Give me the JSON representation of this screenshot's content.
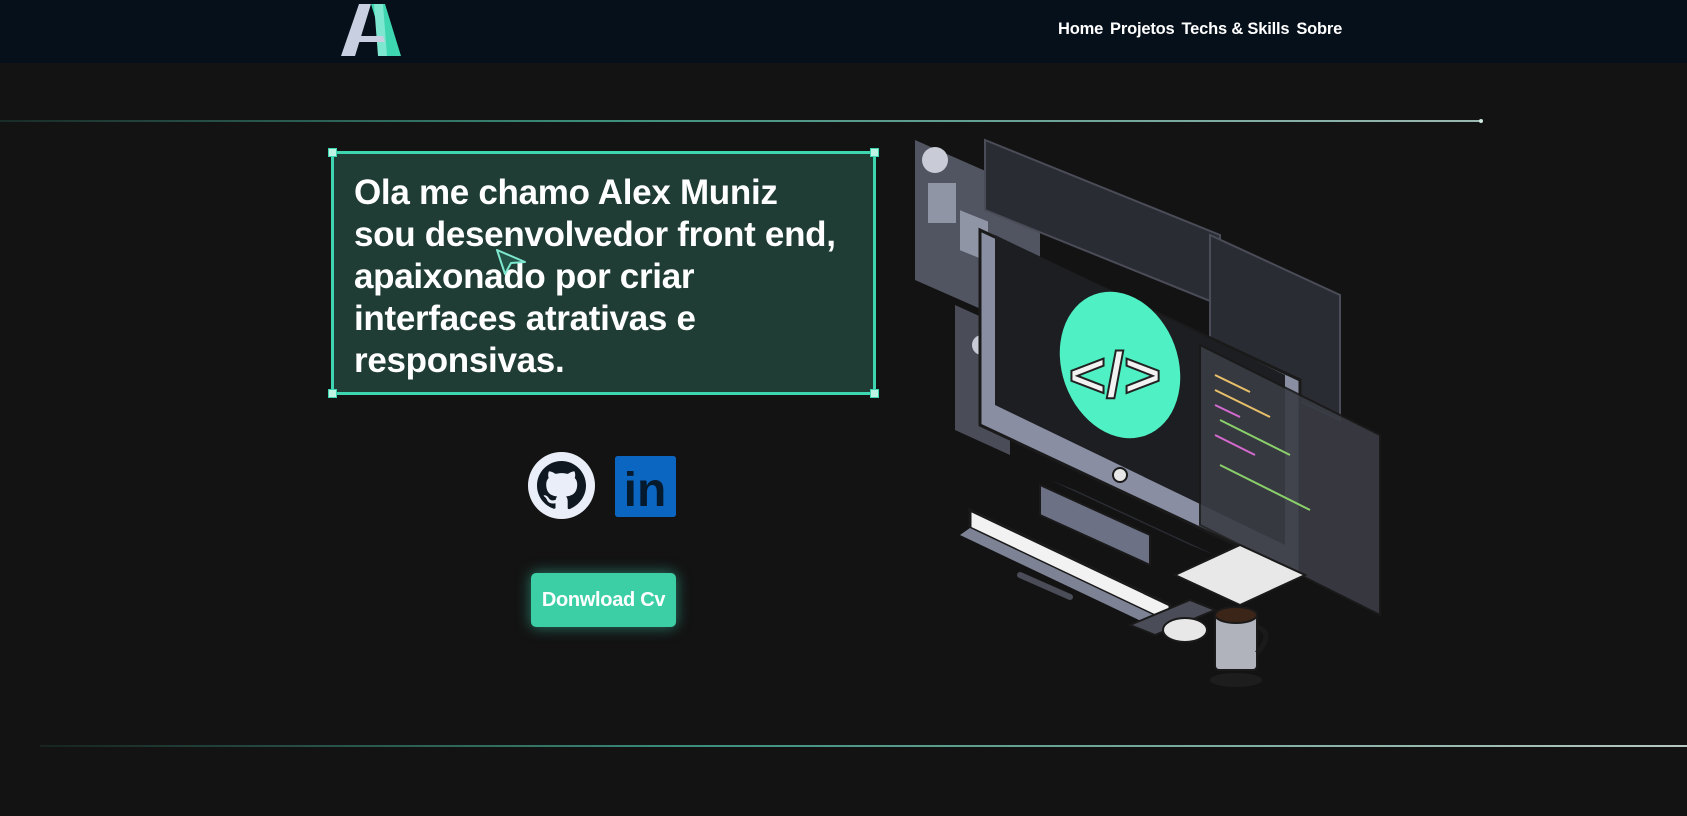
{
  "header": {
    "logo_letter": "A",
    "nav": [
      {
        "label": "Home"
      },
      {
        "label": "Projetos"
      },
      {
        "label": "Techs & Skills"
      },
      {
        "label": "Sobre"
      }
    ]
  },
  "hero": {
    "intro_lines": [
      "Ola me chamo Alex Muniz",
      "sou desenvolvedor front end,",
      "apaixonado por criar",
      "interfaces atrativas e",
      "responsivas."
    ],
    "social": [
      {
        "icon": "github-icon"
      },
      {
        "icon": "linkedin-icon",
        "text": "in"
      }
    ],
    "cv_button_label": "Donwload Cv",
    "illustration_code_symbol": "</>"
  },
  "colors": {
    "background": "#131313",
    "topbar": "#06101a",
    "accent": "#3ed6b0",
    "box": "#1f3d34",
    "linkedin": "#0b66c2",
    "button": "#3ccfa6"
  }
}
